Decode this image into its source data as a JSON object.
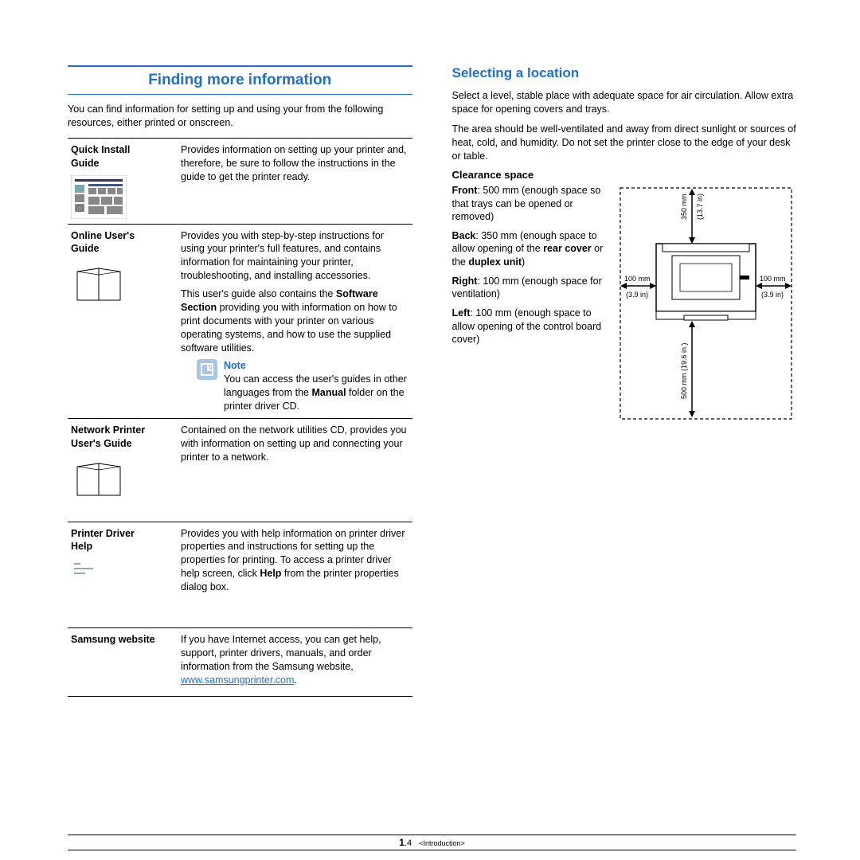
{
  "left": {
    "title": "Finding more information",
    "intro": "You can find information for setting up and using your from the following resources, either printed or onscreen.",
    "rows": [
      {
        "title_l1": "Quick Install",
        "title_l2": "Guide",
        "p1": "Provides information on setting up your printer and, therefore, be sure to follow the instructions in the guide to get the printer ready."
      },
      {
        "title_l1": "Online User's",
        "title_l2": "Guide",
        "p1": "Provides you with step-by-step instructions for using your printer's full features, and contains information for maintaining your printer, troubleshooting, and installing accessories.",
        "p2a": "This user's guide also contains the ",
        "p2b": "Software Section",
        "p2c": " providing you with information on how to print documents with your printer on various operating systems, and how to use the supplied software utilities.",
        "note_title": "Note",
        "note_a": "You can access the user's guides in other languages from the ",
        "note_b": "Manual",
        "note_c": " folder on the printer driver CD."
      },
      {
        "title_l1": "Network Printer",
        "title_l2": "User's Guide",
        "p1": "Contained on the network utilities CD, provides you with information on setting up and connecting your printer to a network."
      },
      {
        "title_l1": "Printer Driver",
        "title_l2": "Help",
        "p1a": "Provides you with help information on printer driver properties and instructions for setting up the properties for printing. To access a printer driver help screen, click ",
        "p1b": "Help",
        "p1c": " from the printer properties dialog box."
      },
      {
        "title_l1": "Samsung website",
        "p1": "If you have Internet access, you can get help, support, printer drivers, manuals, and order information from the Samsung website, ",
        "link": "www.samsungprinter.com",
        "p1end": "."
      }
    ]
  },
  "right": {
    "title": "Selecting a location",
    "p1": "Select a level, stable place with adequate space for air circulation. Allow extra space for opening covers and trays.",
    "p2": "The area should be well-ventilated and away from direct sunlight or sources of heat, cold, and humidity. Do not set the printer close to the edge of your desk or table.",
    "sub": "Clearance space",
    "front_a": "Front",
    "front_b": ": 500 mm (enough space so that trays can be opened or removed)",
    "back_a": "Back",
    "back_b": ": 350 mm (enough space to allow opening of the ",
    "back_c": "rear cover",
    "back_d": " or the ",
    "back_e": "duplex unit",
    "back_f": ")",
    "right_a": "Right",
    "right_b": ": 100 mm (enough space for ventilation)",
    "left_a": "Left",
    "left_b": ": 100 mm (enough space to allow opening of the control board cover)",
    "diag": {
      "top_mm": "350 mm",
      "top_in": "(13.7 in)",
      "side_mm": "100 mm",
      "side_in": "(3.9 in)",
      "bot_mm": "500 mm (19.6 in.)"
    }
  },
  "footer": {
    "page_major": "1",
    "page_minor": ".4",
    "chapter": "<Introduction>"
  }
}
